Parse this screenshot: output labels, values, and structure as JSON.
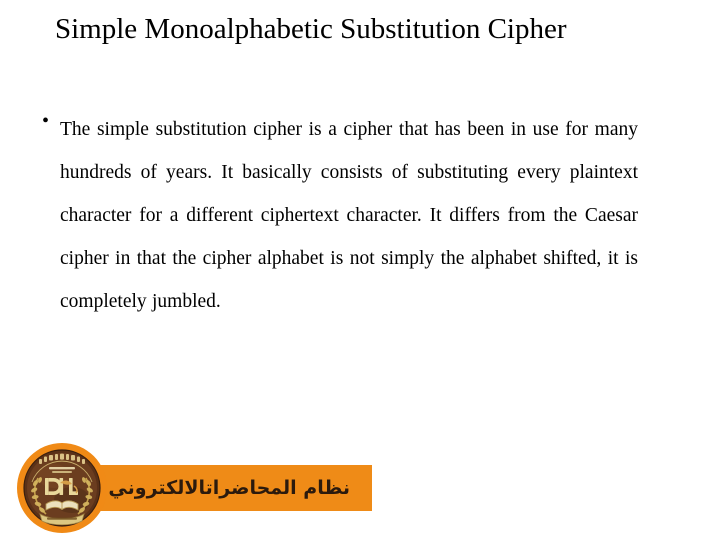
{
  "slide": {
    "title": "Simple Monoalphabetic Substitution Cipher",
    "body_bullet_glyph": "•",
    "body_text": "The simple substitution cipher is a cipher that has been in use for many hundreds of years. It basically consists of substituting every plaintext character for a different ciphertext character. It differs from the Caesar cipher in that the cipher alphabet is not simply the alphabet shifted, it is completely jumbled.",
    "body_lines": [
      "The simple substitution cipher is a cipher that has been in",
      "use for many hundreds of years. It basically consists of",
      "substituting every plaintext character for a different",
      "ciphertext character. It differs from the Caesar cipher in that",
      "the cipher alphabet is not simply the alphabet shifted, it is",
      "completely jumbled."
    ]
  },
  "footer": {
    "banner_text_primary": "نظام المحاضرات",
    "banner_text_secondary": "الالكتروني",
    "logo_name": "Dijlah University College seal",
    "logo_letters": "DIJLAH",
    "logo_arabic_top": "كلية دجلة الجامعة",
    "logo_arabic_center": "دجلة",
    "logo_banner_text": "DIJLAH UNIVERSITY COLLEGE"
  },
  "colors": {
    "background": "#ffffff",
    "text": "#000000",
    "banner_orange": "#ef8b17",
    "seal_dark_brown": "#4a2a16",
    "seal_mid_brown": "#6b3d1f",
    "seal_gold": "#c9a84c",
    "seal_light_gold": "#e8d79a",
    "seal_ring_orange": "#f08a16",
    "arabic_text": "#2b1a0d"
  }
}
